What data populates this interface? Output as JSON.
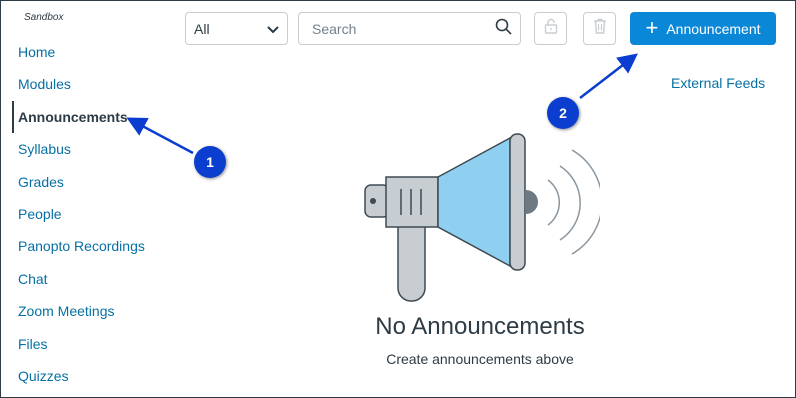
{
  "course": {
    "name": "Sandbox"
  },
  "sidebar": {
    "items": [
      {
        "label": "Home",
        "active": false
      },
      {
        "label": "Modules",
        "active": false
      },
      {
        "label": "Announcements",
        "active": true
      },
      {
        "label": "Syllabus",
        "active": false
      },
      {
        "label": "Grades",
        "active": false
      },
      {
        "label": "People",
        "active": false
      },
      {
        "label": "Panopto Recordings",
        "active": false
      },
      {
        "label": "Chat",
        "active": false
      },
      {
        "label": "Zoom Meetings",
        "active": false
      },
      {
        "label": "Files",
        "active": false
      },
      {
        "label": "Quizzes",
        "active": false
      }
    ]
  },
  "toolbar": {
    "filter_value": "All",
    "search_placeholder": "Search",
    "add_label": "Announcement",
    "external_feeds": "External Feeds"
  },
  "empty_state": {
    "title": "No Announcements",
    "subtitle": "Create announcements above"
  },
  "callouts": [
    {
      "number": "1",
      "target": "Announcements"
    },
    {
      "number": "2",
      "target": "Announcement button"
    }
  ],
  "colors": {
    "link": "#0770a3",
    "primary_button": "#0b87d8",
    "callout": "#0b3ecf",
    "text": "#2d3b45"
  }
}
